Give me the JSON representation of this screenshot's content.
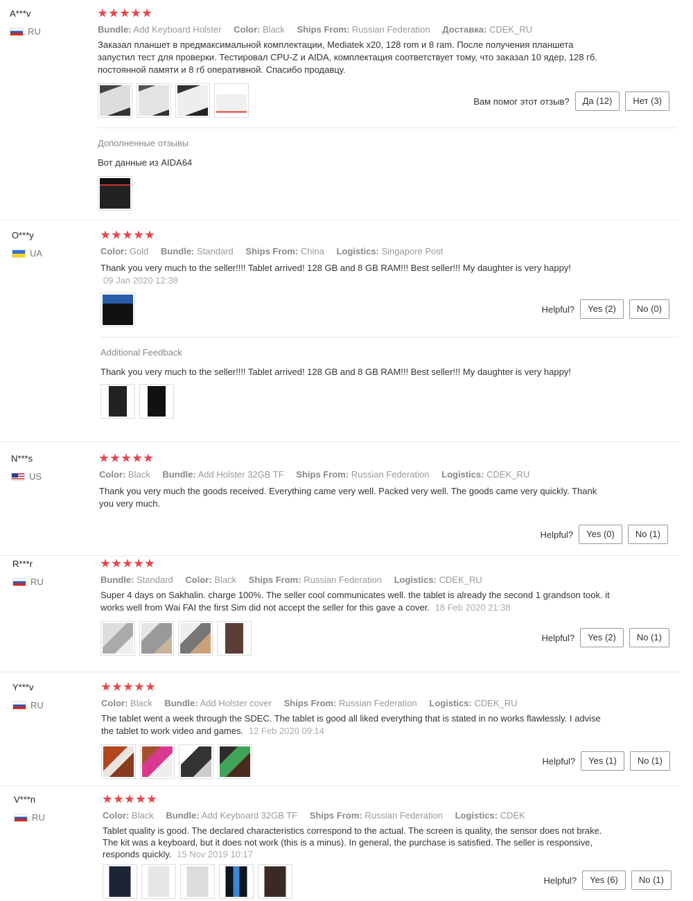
{
  "reviews": [
    {
      "user": "A***v",
      "country": "RU",
      "flag": "ru",
      "attrs": [
        {
          "k": "Bundle:",
          "v": "Add Keyboard Holster"
        },
        {
          "k": "Color:",
          "v": "Black"
        },
        {
          "k": "Ships From:",
          "v": "Russian Federation"
        },
        {
          "k": "Доставка:",
          "v": "CDEK_RU"
        }
      ],
      "text": "Заказал планшет в предмаксимальной комплектации, Mediatek x20, 128 rom и 8 ram. После получения планшета запустил тест для проверки. Тестировал CPU-Z и AIDA, комплектация соответствует тому, что заказал 10 ядер, 128 гб. постоянной памяти и 8 гб оперативной. Спасибо продавцу.",
      "date": "",
      "helpful_label": "Вам помог этот отзыв?",
      "yes": "Да (12)",
      "no": "Нет (3)",
      "additional_title": "Дополненные отзывы",
      "additional_text": "Вот данные из AIDA64"
    },
    {
      "user": "O***y",
      "country": "UA",
      "flag": "ua",
      "attrs": [
        {
          "k": "Color:",
          "v": "Gold"
        },
        {
          "k": "Bundle:",
          "v": "Standard"
        },
        {
          "k": "Ships From:",
          "v": "China"
        },
        {
          "k": "Logistics:",
          "v": "Singapore Post"
        }
      ],
      "text": "Thank you very much to the seller!!!! Tablet arrived! 128 GB and 8 GB RAM!!! Best seller!!! My daughter is very happy!",
      "date": "09 Jan 2020 12:38",
      "helpful_label": "Helpful?",
      "yes": "Yes (2)",
      "no": "No (0)",
      "additional_title": "Additional Feedback",
      "additional_text": "Thank you very much to the seller!!!! Tablet arrived! 128 GB and 8 GB RAM!!! Best seller!!! My daughter is very happy!"
    },
    {
      "user": "N***s",
      "country": "US",
      "flag": "us",
      "attrs": [
        {
          "k": "Color:",
          "v": "Black"
        },
        {
          "k": "Bundle:",
          "v": "Add Holster 32GB TF"
        },
        {
          "k": "Ships From:",
          "v": "Russian Federation"
        },
        {
          "k": "Logistics:",
          "v": "CDEK_RU"
        }
      ],
      "text": "Thank you very much the goods received. Everything came very well. Packed very well. The goods came very quickly. Thank you very much.",
      "date": "",
      "helpful_label": "Helpful?",
      "yes": "Yes (0)",
      "no": "No (1)"
    },
    {
      "user": "R***r",
      "country": "RU",
      "flag": "ru",
      "attrs": [
        {
          "k": "Bundle:",
          "v": "Standard"
        },
        {
          "k": "Color:",
          "v": "Black"
        },
        {
          "k": "Ships From:",
          "v": "Russian Federation"
        },
        {
          "k": "Logistics:",
          "v": "CDEK_RU"
        }
      ],
      "text": "Super 4 days on Sakhalin. charge 100%. The seller cool communicates well. the tablet is already the second 1 grandson took. it works well from Wai FAI the first Sim did not accept the seller for this gave a cover.",
      "date": "18 Feb 2020 21:38",
      "helpful_label": "Helpful?",
      "yes": "Yes (2)",
      "no": "No (1)"
    },
    {
      "user": "Y***v",
      "country": "RU",
      "flag": "ru",
      "attrs": [
        {
          "k": "Color:",
          "v": "Black"
        },
        {
          "k": "Bundle:",
          "v": "Add Holster cover"
        },
        {
          "k": "Ships From:",
          "v": "Russian Federation"
        },
        {
          "k": "Logistics:",
          "v": "CDEK_RU"
        }
      ],
      "text": "The tablet went a week through the SDEC. The tablet is good all liked everything that is stated in no works flawlessly. I advise the tablet to work video and games.",
      "date": "12 Feb 2020 09:14",
      "helpful_label": "Helpful?",
      "yes": "Yes (1)",
      "no": "No (1)"
    },
    {
      "user": "V***n",
      "country": "RU",
      "flag": "ru",
      "attrs": [
        {
          "k": "Color:",
          "v": "Black"
        },
        {
          "k": "Bundle:",
          "v": "Add Keyboard 32GB TF"
        },
        {
          "k": "Ships From:",
          "v": "Russian Federation"
        },
        {
          "k": "Logistics:",
          "v": "CDEK"
        }
      ],
      "text": "Tablet quality is good. The declared characteristics correspond to the actual. The screen is quality, the sensor does not brake. The kit was a keyboard, but it does not work (this is a minus). In general, the purchase is satisfied. The seller is responsive, responds quickly.",
      "date": "15 Nov 2019 10:17",
      "helpful_label": "Helpful?",
      "yes": "Yes (6)",
      "no": "No (1)"
    }
  ]
}
